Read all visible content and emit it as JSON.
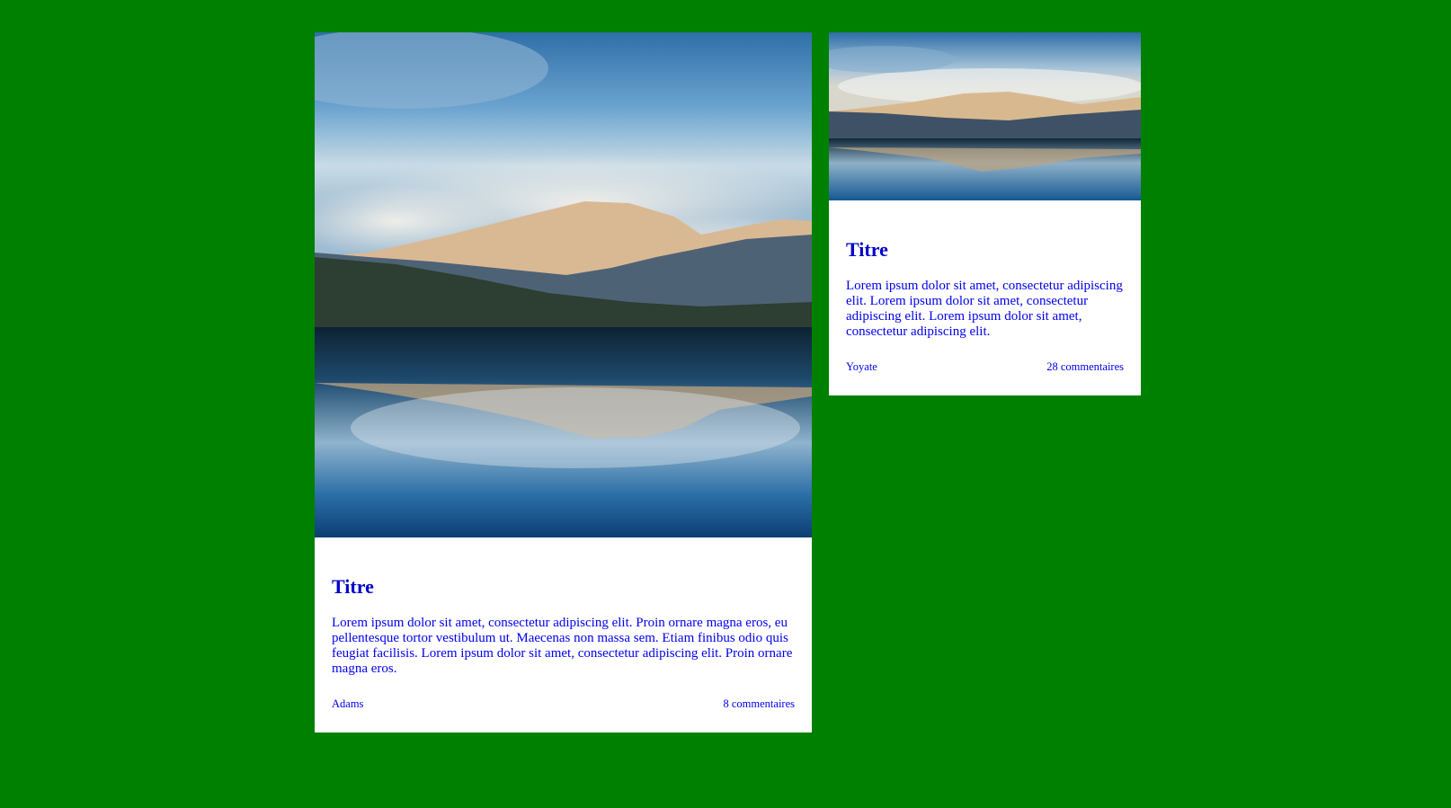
{
  "colors": {
    "background": "#008000",
    "card": "#ffffff",
    "text": "#0000ee"
  },
  "cards": [
    {
      "image": "mountain-lake-photo",
      "title": "Titre",
      "text": "Lorem ipsum dolor sit amet, consectetur adipiscing elit. Proin ornare magna eros, eu pellentesque tortor vestibulum ut. Maecenas non massa sem. Etiam finibus odio quis feugiat facilisis. Lorem ipsum dolor sit amet, consectetur adipiscing elit. Proin ornare magna eros.",
      "author": "Adams",
      "comments": "8 commentaires"
    },
    {
      "image": "mountain-lake-photo",
      "title": "Titre",
      "text": "Lorem ipsum dolor sit amet, consectetur adipiscing elit. Lorem ipsum dolor sit amet, consectetur adipiscing elit. Lorem ipsum dolor sit amet, consectetur adipiscing elit.",
      "author": "Yoyate",
      "comments": "28 commentaires"
    }
  ]
}
